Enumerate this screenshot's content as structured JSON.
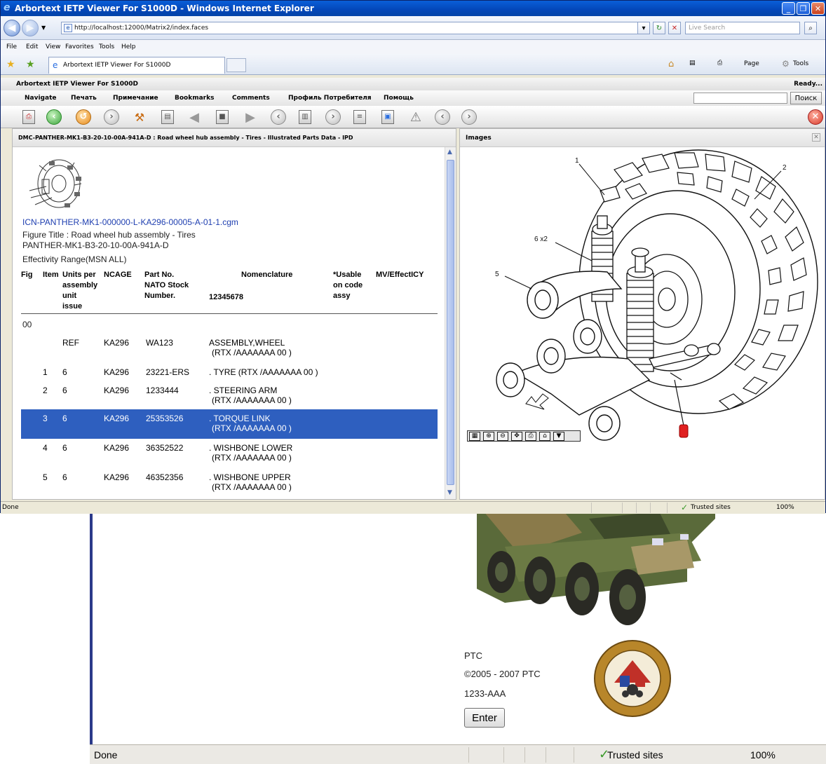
{
  "window": {
    "title": "Arbortext IETP Viewer For S1000D - Windows Internet Explorer",
    "url": "http://localhost:12000/Matrix2/index.faces",
    "search_placeholder": "Live Search",
    "menu": [
      "File",
      "Edit",
      "View",
      "Favorites",
      "Tools",
      "Help"
    ],
    "tab_label": "Arbortext IETP Viewer For S1000D",
    "cmd": {
      "page": "Page",
      "tools": "Tools"
    },
    "status": {
      "left": "Done",
      "zone": "Trusted sites",
      "zoom": "100%"
    }
  },
  "app": {
    "header_title": "Arbortext IETP Viewer For S1000D",
    "header_status": "Ready...",
    "menu": {
      "navigate": "Navigate",
      "print": "Печать",
      "notes": "Примечание",
      "bookmarks": "Bookmarks",
      "comments": "Comments",
      "profile": "Профиль Потребителя",
      "help": "Помощь"
    },
    "search_button": "Поиск",
    "toolbar_icons": [
      "print-icon",
      "back-icon",
      "history-icon",
      "forward-icon",
      "tools-icon",
      "notes-icon",
      "prev-step-icon",
      "stop-icon",
      "next-step-icon",
      "prev-page-icon",
      "book-icon",
      "next-page-icon",
      "document-icon",
      "image-icon",
      "warning-icon",
      "prev-section-icon",
      "next-section-icon",
      "close-icon"
    ]
  },
  "left_pane": {
    "header": "DMC-PANTHER-MK1-B3-20-10-00A-941A-D : Road wheel hub assembly - Tires - Illustrated Parts Data - IPD",
    "icn_link": "ICN-PANTHER-MK1-000000-L-KA296-00005-A-01-1.cgm",
    "figure_title": "Figure Title : Road wheel hub assembly - Tires",
    "figure_code": "PANTHER-MK1-B3-20-10-00A-941A-D",
    "effectivity": "Effectivity Range(MSN ALL)",
    "table": {
      "headers": {
        "fig": "Fig",
        "item": "Item",
        "units": [
          "Units per",
          "assembly",
          "unit",
          "issue"
        ],
        "ncage": "NCAGE",
        "part": [
          "Part No.",
          "NATO Stock",
          "Number."
        ],
        "nomenclature": "Nomenclature",
        "nomenclature_sub": "12345678",
        "usable": [
          "*Usable",
          "on code",
          "assy"
        ],
        "mv": "MV/EffectICY"
      },
      "fig_number": "00",
      "rows": [
        {
          "item": "",
          "units": "REF",
          "ncage": "KA296",
          "part": "WA123",
          "nom1": "ASSEMBLY,WHEEL",
          "nom2": "(RTX /AAAAAAA 00 )"
        },
        {
          "item": "1",
          "units": "6",
          "ncage": "KA296",
          "part": "23221-ERS",
          "nom1": ". TYRE (RTX /AAAAAAA 00 )",
          "nom2": ""
        },
        {
          "item": "2",
          "units": "6",
          "ncage": "KA296",
          "part": "1233444",
          "nom1": ". STEERING ARM",
          "nom2": "(RTX /AAAAAAA 00 )"
        },
        {
          "item": "3",
          "units": "6",
          "ncage": "KA296",
          "part": "25353526",
          "nom1": ". TORQUE LINK",
          "nom2": "(RTX /AAAAAAA 00 )"
        },
        {
          "item": "4",
          "units": "6",
          "ncage": "KA296",
          "part": "36352522",
          "nom1": ". WISHBONE LOWER",
          "nom2": "(RTX /AAAAAAA 00 )"
        },
        {
          "item": "5",
          "units": "6",
          "ncage": "KA296",
          "part": "46352356",
          "nom1": ". WISHBONE UPPER",
          "nom2": "(RTX /AAAAAAA 00 )"
        }
      ]
    }
  },
  "right_pane": {
    "header": "Images",
    "callouts": {
      "c1": "1",
      "c2": "2",
      "c5": "5",
      "c6": "6 x2"
    }
  },
  "background_window": {
    "company": "PTC",
    "copyright": "©2005 - 2007 PTC",
    "code": "1233-AAA",
    "enter_button": "Enter",
    "status": {
      "left": "Done",
      "zone": "Trusted sites",
      "zoom": "100%"
    }
  },
  "colors": {
    "selection": "#2e5fbf",
    "title_bar": "#0346b8",
    "link": "#1f3fb0"
  }
}
